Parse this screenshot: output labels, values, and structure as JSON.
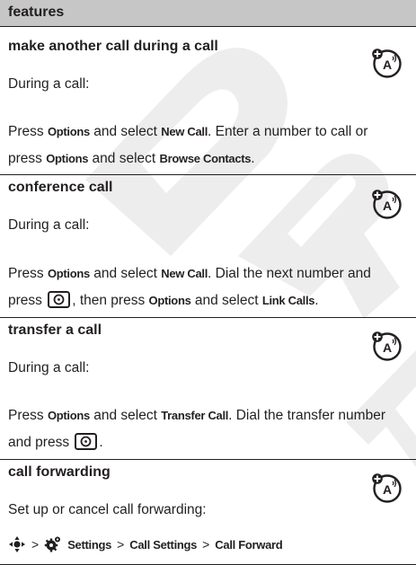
{
  "header": {
    "title": "features"
  },
  "sections": [
    {
      "title": "make another call during a call",
      "intro": "During a call:",
      "step": {
        "t1": "Press ",
        "k1": "Options",
        "t2": " and select ",
        "k2": "New Call",
        "t3": ". Enter a number to call or press ",
        "k3": "Options",
        "t4": " and select ",
        "k4": "Browse Contacts",
        "t5": "."
      }
    },
    {
      "title": "conference call",
      "intro": "During a call:",
      "step": {
        "t1": "Press ",
        "k1": "Options",
        "t2": " and select ",
        "k2": "New Call",
        "t3": ". Dial the next number and press ",
        "t4": ", then press ",
        "k3": "Options",
        "t5": " and select ",
        "k4": "Link Calls",
        "t6": "."
      }
    },
    {
      "title": "transfer a call",
      "intro": "During a call:",
      "step": {
        "t1": "Press ",
        "k1": "Options",
        "t2": " and select ",
        "k2": "Transfer Call",
        "t3": ". Dial the transfer number and press ",
        "t4": "."
      }
    },
    {
      "title": "call forwarding",
      "intro": "Set up or cancel call forwarding:",
      "nav": {
        "sep": ">",
        "settings": "Settings",
        "call_settings": "Call Settings",
        "call_forward": "Call Forward"
      }
    }
  ],
  "icons": {
    "network_feature": "network-feature-icon",
    "send_key": "send-key-icon",
    "nav_key": "nav-key-icon",
    "settings": "settings-gear-icon"
  },
  "colors": {
    "header_bg": "#c6c6c6",
    "section_bg": "#e6e6e6",
    "text": "#231f20",
    "watermark": "#ededed"
  }
}
